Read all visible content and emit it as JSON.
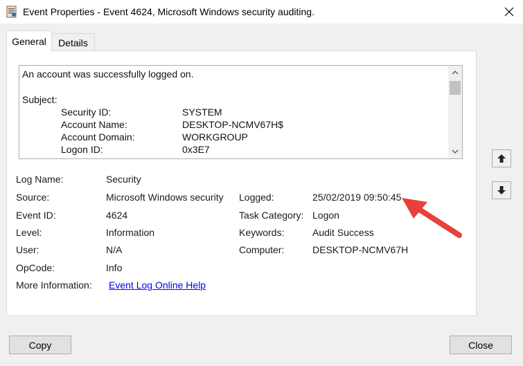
{
  "window": {
    "title": "Event Properties - Event 4624, Microsoft Windows security auditing.",
    "app_icon": "event-viewer-icon",
    "close_icon": "close-icon"
  },
  "tabs": [
    {
      "label": "General",
      "selected": true
    },
    {
      "label": "Details",
      "selected": false
    }
  ],
  "description": {
    "line1": "An account was successfully logged on.",
    "subject_label": "Subject:",
    "fields": [
      {
        "label": "Security ID:",
        "value": "SYSTEM"
      },
      {
        "label": "Account Name:",
        "value": "DESKTOP-NCMV67H$"
      },
      {
        "label": "Account Domain:",
        "value": "WORKGROUP"
      },
      {
        "label": "Logon ID:",
        "value": "0x3E7"
      }
    ]
  },
  "details": {
    "log_name": {
      "label": "Log Name:",
      "value": "Security"
    },
    "source": {
      "label": "Source:",
      "value": "Microsoft Windows security"
    },
    "logged": {
      "label": "Logged:",
      "value": "25/02/2019 09:50:45"
    },
    "event_id": {
      "label": "Event ID:",
      "value": "4624"
    },
    "task_category": {
      "label": "Task Category:",
      "value": "Logon"
    },
    "level": {
      "label": "Level:",
      "value": "Information"
    },
    "keywords": {
      "label": "Keywords:",
      "value": "Audit Success"
    },
    "user": {
      "label": "User:",
      "value": "N/A"
    },
    "computer": {
      "label": "Computer:",
      "value": "DESKTOP-NCMV67H"
    },
    "opcode": {
      "label": "OpCode:",
      "value": "Info"
    },
    "more_info": {
      "label": "More Information:",
      "value": "Event Log Online Help"
    }
  },
  "buttons": {
    "copy": "Copy",
    "close": "Close"
  },
  "colors": {
    "annotation_arrow": "#e8403a",
    "link": "#0000ee"
  }
}
